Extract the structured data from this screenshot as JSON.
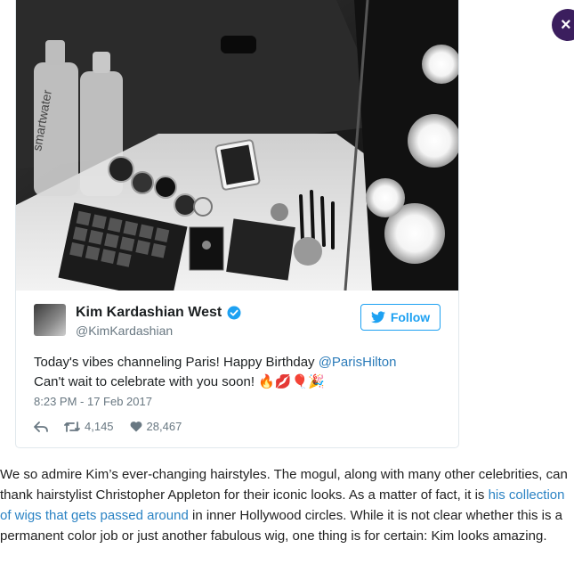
{
  "tweet": {
    "author_name": "Kim Kardashian West",
    "handle": "@KimKardashian",
    "follow_label": "Follow",
    "text_line1_prefix": "Today's vibes channeling Paris! Happy Birthday ",
    "mention": "@ParisHilton",
    "text_line2": "Can't wait to celebrate with you soon! ",
    "emojis": "🔥💋🎈🎉",
    "timestamp": "8:23 PM - 17 Feb 2017",
    "retweets": "4,145",
    "likes": "28,467",
    "accent_color": "#1da1f2"
  },
  "photo": {
    "bottle_label": "smartwater"
  },
  "article": {
    "before_link": "We so admire Kim’s ever-changing hairstyles. The mogul, along with many other celebrities, can thank hairstylist Christopher Appleton for their iconic looks. As a matter of fact, it is ",
    "link_text": "his collection of wigs that gets passed around",
    "after_link": " in inner Hollywood circles. While it is not clear whether this is a permanent color job or just another fabulous wig, one thing is for certain: Kim looks amazing."
  },
  "close_button": {
    "label": "×",
    "color": "#3b1e5e"
  }
}
